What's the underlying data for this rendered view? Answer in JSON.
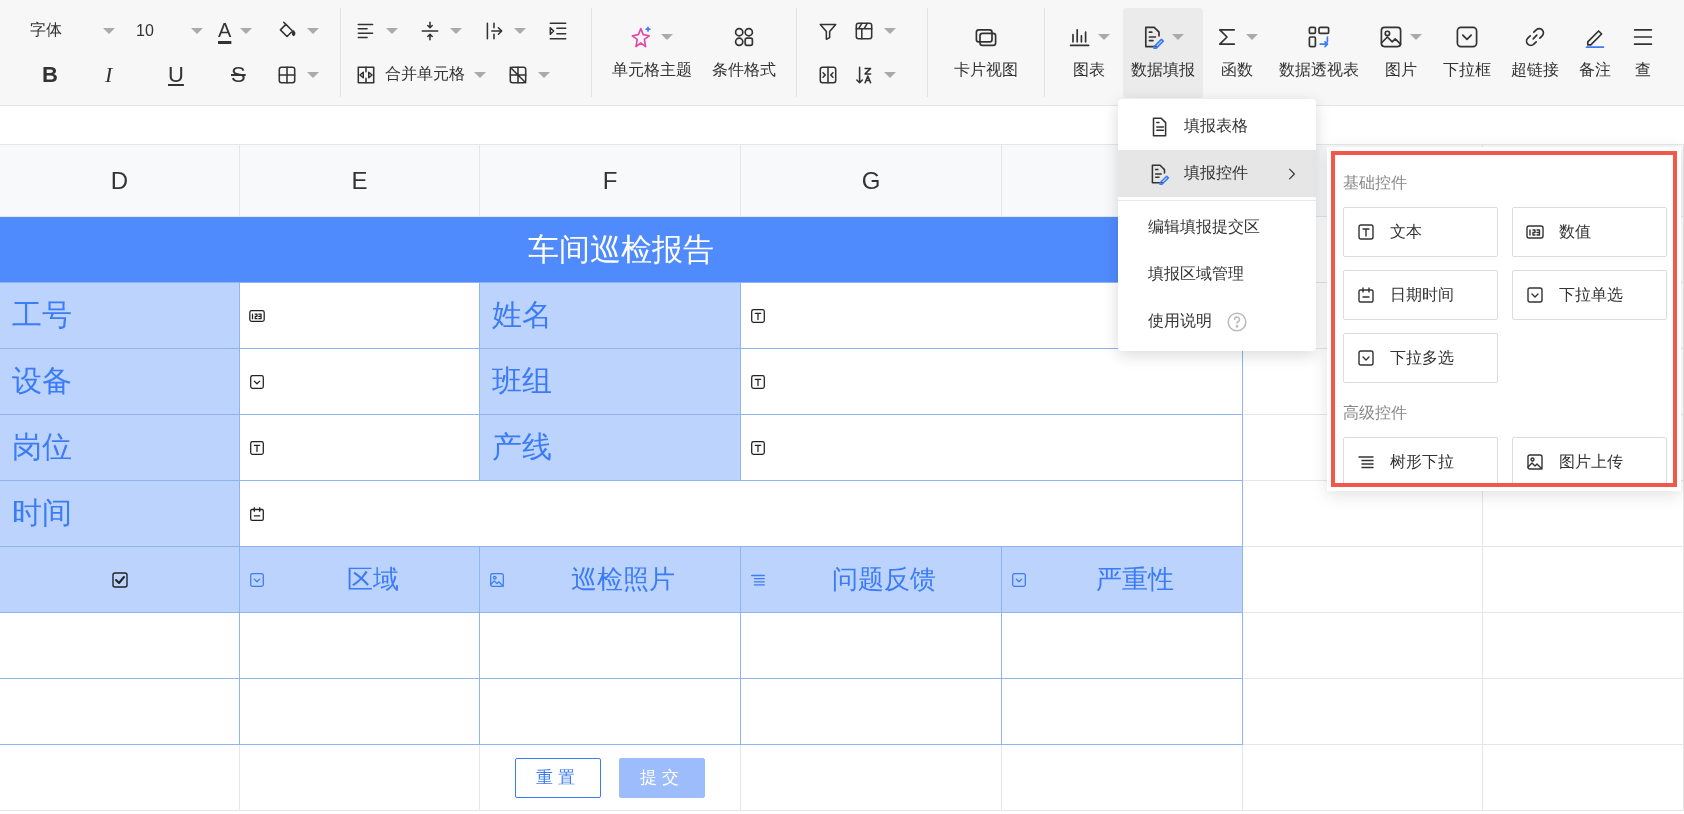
{
  "toolbar": {
    "font_name": "字体",
    "font_size": "10",
    "font_color": "A",
    "format_buttons": [
      {
        "label": "B"
      },
      {
        "label": "I"
      },
      {
        "label": "U"
      },
      {
        "label": "S"
      }
    ],
    "merge_cells": "合并单元格",
    "large_buttons": [
      {
        "label": "单元格主题",
        "selected": false
      },
      {
        "label": "条件格式",
        "selected": false
      },
      {
        "label": "卡片视图",
        "selected": false
      },
      {
        "label": "图表",
        "selected": false
      },
      {
        "label": "数据填报",
        "selected": true
      },
      {
        "label": "函数",
        "selected": false
      },
      {
        "label": "数据透视表",
        "selected": false
      },
      {
        "label": "图片",
        "selected": false
      },
      {
        "label": "下拉框",
        "selected": false
      },
      {
        "label": "超链接",
        "selected": false
      },
      {
        "label": "备注",
        "selected": false
      },
      {
        "label": "查",
        "selected": false
      }
    ]
  },
  "sheet": {
    "columns": [
      {
        "label": "D"
      },
      {
        "label": "E"
      },
      {
        "label": "F"
      },
      {
        "label": "G"
      }
    ],
    "title": "车间巡检报告",
    "form_rows": [
      [
        {
          "label": "工号",
          "kind": "number"
        },
        {
          "label": "姓名",
          "kind": "text"
        }
      ],
      [
        {
          "label": "设备",
          "kind": "dropdown"
        },
        {
          "label": "班组",
          "kind": "text"
        }
      ],
      [
        {
          "label": "岗位",
          "kind": "text"
        },
        {
          "label": "产线",
          "kind": "text"
        }
      ],
      [
        {
          "label": "时间",
          "kind": "date"
        }
      ]
    ],
    "table_header": [
      {
        "kind": "checkbox",
        "checked": true
      },
      {
        "kind": "dropdown",
        "label": "区域"
      },
      {
        "kind": "image",
        "label": "巡检照片"
      },
      {
        "kind": "tree",
        "label": "问题反馈"
      },
      {
        "kind": "dropdown",
        "label": "严重性"
      }
    ],
    "buttons": [
      {
        "label": "重置",
        "disabled": false
      },
      {
        "label": "提交",
        "disabled": true
      }
    ]
  },
  "menu": {
    "items": [
      {
        "label": "填报表格",
        "kind": "doc",
        "selected": false
      },
      {
        "label": "填报控件",
        "kind": "submenu",
        "selected": true
      },
      {
        "label": "编辑填报提交区",
        "kind": "plain",
        "selected": false
      },
      {
        "label": "填报区域管理",
        "kind": "plain",
        "selected": false
      },
      {
        "label": "使用说明",
        "kind": "help",
        "selected": false
      }
    ]
  },
  "submenu": {
    "highlighted": true,
    "sections": [
      {
        "title": "基础控件",
        "items": [
          {
            "label": "文本",
            "kind": "text"
          },
          {
            "label": "数值",
            "kind": "number"
          },
          {
            "label": "日期时间",
            "kind": "date"
          },
          {
            "label": "下拉单选",
            "kind": "dropdown"
          },
          {
            "label": "下拉多选",
            "kind": "dropdown"
          }
        ]
      },
      {
        "title": "高级控件",
        "items": [
          {
            "label": "树形下拉",
            "kind": "tree"
          },
          {
            "label": "图片上传",
            "kind": "image"
          }
        ]
      }
    ]
  }
}
